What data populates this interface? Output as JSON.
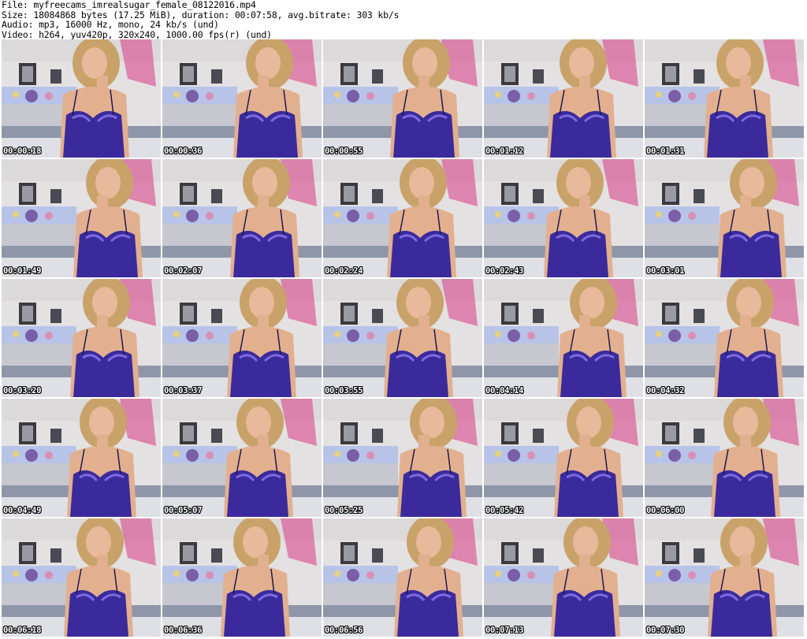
{
  "info": {
    "file": "File: myfreecams_imrealsugar_female_08122016.mp4",
    "size": "Size: 18084868 bytes (17.25 MiB), duration: 00:07:58, avg.bitrate: 303 kb/s",
    "audio": "Audio: mp3, 16000 Hz, mono, 24 kb/s (und)",
    "video": "Video: h264, yuv420p, 320x240, 1000.00 fps(r) (und)"
  },
  "thumbnails": [
    {
      "timestamp": "00:00:18"
    },
    {
      "timestamp": "00:00:36"
    },
    {
      "timestamp": "00:00:55"
    },
    {
      "timestamp": "00:01:12"
    },
    {
      "timestamp": "00:01:31"
    },
    {
      "timestamp": "00:01:49"
    },
    {
      "timestamp": "00:02:07"
    },
    {
      "timestamp": "00:02:24"
    },
    {
      "timestamp": "00:02:43"
    },
    {
      "timestamp": "00:03:01"
    },
    {
      "timestamp": "00:03:20"
    },
    {
      "timestamp": "00:03:37"
    },
    {
      "timestamp": "00:03:55"
    },
    {
      "timestamp": "00:04:14"
    },
    {
      "timestamp": "00:04:32"
    },
    {
      "timestamp": "00:04:49"
    },
    {
      "timestamp": "00:05:07"
    },
    {
      "timestamp": "00:05:25"
    },
    {
      "timestamp": "00:05:42"
    },
    {
      "timestamp": "00:06:00"
    },
    {
      "timestamp": "00:06:18"
    },
    {
      "timestamp": "00:06:36"
    },
    {
      "timestamp": "00:06:56"
    },
    {
      "timestamp": "00:07:13"
    },
    {
      "timestamp": "00:07:30"
    }
  ],
  "colors": {
    "wall": "#e6e3e5",
    "pink_accent": "#d9488a",
    "skin": "#e8b99a",
    "hair": "#c9a26a",
    "lingerie": "#3b2a9c",
    "lingerie_shine": "#7b6ae0",
    "rug": "#8f96aa",
    "desk": "#f2f2f4"
  }
}
